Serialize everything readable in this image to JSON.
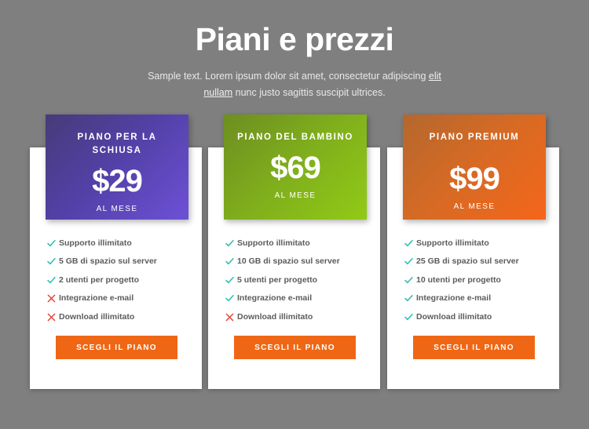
{
  "header": {
    "title": "Piani e prezzi",
    "subtitle_before": "Sample text. Lorem ipsum dolor sit amet, consectetur adipiscing ",
    "subtitle_link": "elit nullam",
    "subtitle_after": " nunc justo sagittis suscipit ultrices."
  },
  "colors": {
    "background": "#7f7f7f",
    "plan1_gradient_start": "#473b78",
    "plan1_gradient_end": "#6d51d6",
    "plan2_gradient_start": "#6d8e21",
    "plan2_gradient_end": "#91ca16",
    "plan3_gradient_start": "#b4672e",
    "plan3_gradient_end": "#f5661a",
    "cta_button": "#ef6715",
    "check_icon": "#26bfae",
    "cross_icon": "#e8453c",
    "feature_text": "#5c5c5c"
  },
  "plans": [
    {
      "name": "PIANO PER LA SCHIUSA",
      "price": "$29",
      "period": "AL MESE",
      "cta_label": "SCEGLI IL PIANO",
      "features": [
        {
          "label": "Supporto illimitato",
          "icon": "check-icon",
          "included": true
        },
        {
          "label": "5 GB di spazio sul server",
          "icon": "check-icon",
          "included": true
        },
        {
          "label": "2 utenti per progetto",
          "icon": "check-icon",
          "included": true
        },
        {
          "label": "Integrazione e-mail",
          "icon": "cross-icon",
          "included": false
        },
        {
          "label": "Download illimitato",
          "icon": "cross-icon",
          "included": false
        }
      ]
    },
    {
      "name": "PIANO DEL BAMBINO",
      "price": "$69",
      "period": "AL MESE",
      "cta_label": "SCEGLI IL PIANO",
      "features": [
        {
          "label": "Supporto illimitato",
          "icon": "check-icon",
          "included": true
        },
        {
          "label": "10 GB di spazio sul server",
          "icon": "check-icon",
          "included": true
        },
        {
          "label": "5 utenti per progetto",
          "icon": "check-icon",
          "included": true
        },
        {
          "label": "Integrazione e-mail",
          "icon": "check-icon",
          "included": true
        },
        {
          "label": "Download illimitato",
          "icon": "cross-icon",
          "included": false
        }
      ]
    },
    {
      "name": "PIANO PREMIUM",
      "price": "$99",
      "period": "AL MESE",
      "cta_label": "SCEGLI IL PIANO",
      "features": [
        {
          "label": "Supporto illimitato",
          "icon": "check-icon",
          "included": true
        },
        {
          "label": "25 GB di spazio sul server",
          "icon": "check-icon",
          "included": true
        },
        {
          "label": "10 utenti per progetto",
          "icon": "check-icon",
          "included": true
        },
        {
          "label": "Integrazione e-mail",
          "icon": "check-icon",
          "included": true
        },
        {
          "label": "Download illimitato",
          "icon": "check-icon",
          "included": true
        }
      ]
    }
  ]
}
